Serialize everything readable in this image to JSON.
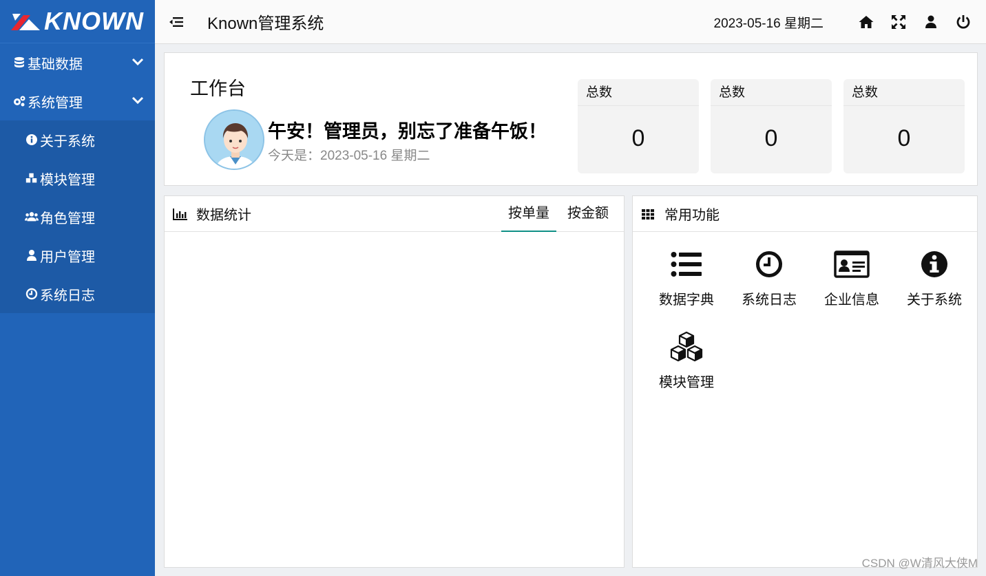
{
  "brand": {
    "logo_text": "KNOWN",
    "accent": "#2164b8",
    "logo_mark_color": "#e8262f"
  },
  "sidebar": {
    "groups": [
      {
        "label": "基础数据",
        "icon": "database-icon"
      },
      {
        "label": "系统管理",
        "icon": "cogs-icon"
      }
    ],
    "sub_items": [
      {
        "label": "关于系统",
        "icon": "info-circle-icon"
      },
      {
        "label": "模块管理",
        "icon": "cubes-icon"
      },
      {
        "label": "角色管理",
        "icon": "users-icon"
      },
      {
        "label": "用户管理",
        "icon": "user-icon"
      },
      {
        "label": "系统日志",
        "icon": "clock-icon"
      }
    ]
  },
  "header": {
    "title": "Known管理系统",
    "date": "2023-05-16 星期二",
    "icons": [
      "home-icon",
      "fullscreen-icon",
      "user-icon",
      "power-icon"
    ]
  },
  "workbench": {
    "title": "工作台",
    "greeting": "午安！管理员，别忘了准备午饭！",
    "today": "今天是：2023-05-16 星期二",
    "stats": [
      {
        "title": "总数",
        "value": "0"
      },
      {
        "title": "总数",
        "value": "0"
      },
      {
        "title": "总数",
        "value": "0"
      }
    ]
  },
  "stats_panel": {
    "title": "数据统计",
    "tabs": [
      "按单量",
      "按金额"
    ],
    "active_tab": "按单量"
  },
  "func_panel": {
    "title": "常用功能",
    "items": [
      {
        "label": "数据字典",
        "icon": "list-icon"
      },
      {
        "label": "系统日志",
        "icon": "clock-icon"
      },
      {
        "label": "企业信息",
        "icon": "id-card-icon"
      },
      {
        "label": "关于系统",
        "icon": "info-circle-icon"
      },
      {
        "label": "模块管理",
        "icon": "cubes-icon"
      }
    ]
  },
  "watermark": "CSDN @W清风大侠M"
}
